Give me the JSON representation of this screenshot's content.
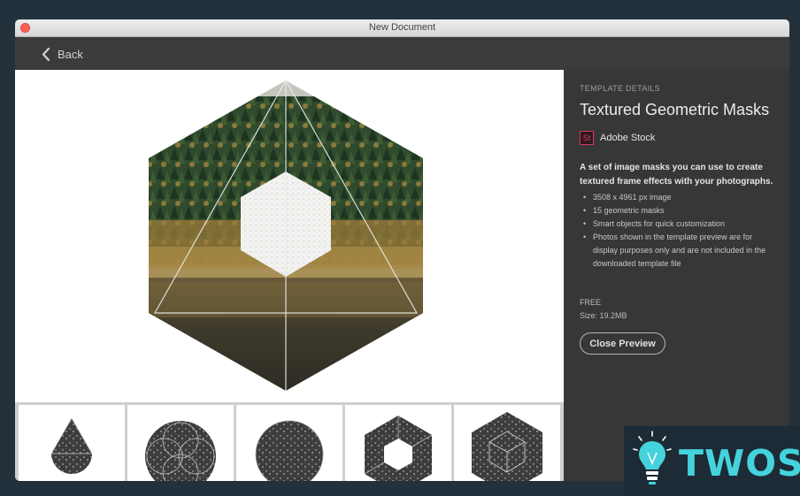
{
  "window": {
    "title": "New Document",
    "close_color": "#fc5f57"
  },
  "toolbar": {
    "back_label": "Back"
  },
  "preview": {
    "image_description_icon": "hexagon-forest-mask"
  },
  "thumbnails": [
    {
      "shape": "drop-triangle"
    },
    {
      "shape": "flower-circle"
    },
    {
      "shape": "circle"
    },
    {
      "shape": "hexagon-ring"
    },
    {
      "shape": "cube-hexagon"
    }
  ],
  "details": {
    "section_label": "TEMPLATE DETAILS",
    "title": "Textured Geometric Masks",
    "vendor_badge": "St",
    "vendor_name": "Adobe Stock",
    "description": "A set of image masks you can use to create textured frame effects with your photographs.",
    "bullets": [
      "3508 x 4961 px image",
      "15 geometric masks",
      "Smart objects for quick customization",
      "Photos shown in the template preview are for display purposes only and are not included in the downloaded template file"
    ],
    "price": "FREE",
    "size": "Size: 19.2MB",
    "close_button": "Close Preview",
    "accent_badge_color": "#e0365f"
  },
  "watermark": {
    "text": "TWOS",
    "color": "#44d3dc"
  }
}
